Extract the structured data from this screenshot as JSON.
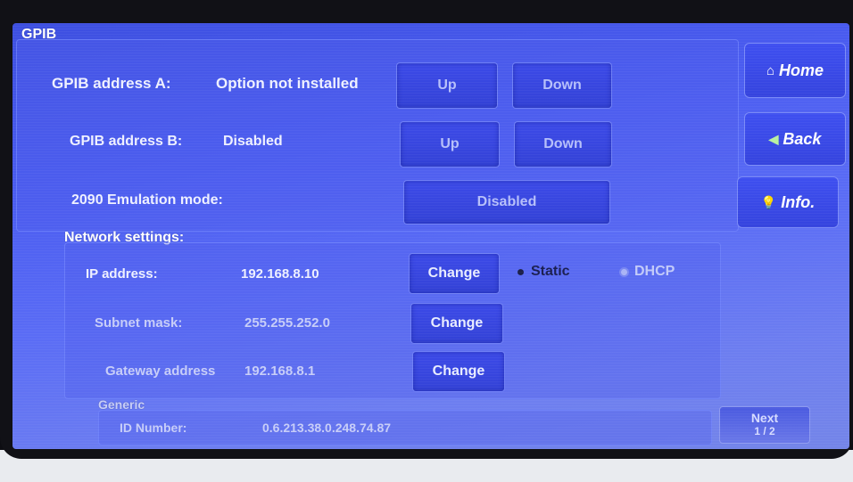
{
  "gpib": {
    "title": "GPIB",
    "address_a": {
      "label": "GPIB address A:",
      "value": "Option not installed",
      "up": "Up",
      "down": "Down"
    },
    "address_b": {
      "label": "GPIB address B:",
      "value": "Disabled",
      "up": "Up",
      "down": "Down"
    },
    "emulation": {
      "label": "2090 Emulation mode:",
      "button": "Disabled"
    }
  },
  "network": {
    "title": "Network settings:",
    "ip": {
      "label": "IP address:",
      "value": "192.168.8.10",
      "button": "Change"
    },
    "mode": {
      "selected": "Static",
      "options": [
        "Static",
        "DHCP"
      ]
    },
    "subnet": {
      "label": "Subnet mask:",
      "value": "255.255.252.0",
      "button": "Change"
    },
    "gateway": {
      "label": "Gateway address",
      "value": "192.168.8.1",
      "button": "Change"
    }
  },
  "generic": {
    "title": "Generic",
    "id_label": "ID Number:",
    "id_value": "0.6.213.38.0.248.74.87"
  },
  "sidebar": {
    "home": "Home",
    "back": "Back",
    "info": "Info."
  },
  "pager": {
    "next": "Next",
    "page": "1 / 2"
  },
  "colors": {
    "screen": "#4a5cf0",
    "button": "#3342d6",
    "text": "#ffffff"
  }
}
